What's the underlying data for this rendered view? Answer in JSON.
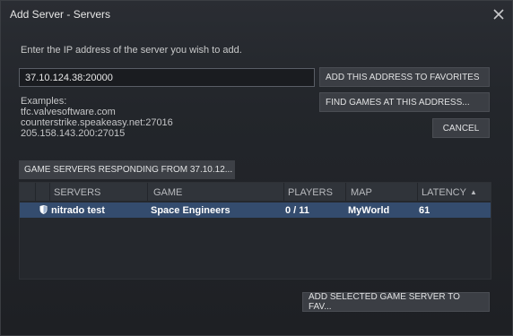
{
  "window": {
    "title": "Add Server - Servers"
  },
  "form": {
    "prompt": "Enter the IP address of the server you wish to add.",
    "ip_value": "37.10.124.38:20000"
  },
  "buttons": {
    "add_to_favorites": "ADD THIS ADDRESS TO FAVORITES",
    "find_games": "FIND GAMES AT THIS ADDRESS...",
    "cancel": "CANCEL",
    "add_selected": "ADD SELECTED GAME SERVER TO FAV..."
  },
  "examples": {
    "heading": "Examples:",
    "lines": [
      "tfc.valvesoftware.com",
      "counterstrike.speakeasy.net:27016",
      "205.158.143.200:27015"
    ]
  },
  "tab": {
    "label": "GAME SERVERS RESPONDING FROM 37.10.12..."
  },
  "table": {
    "columns": [
      "SERVERS",
      "GAME",
      "PLAYERS",
      "MAP",
      "LATENCY"
    ],
    "sort_indicator": "▲",
    "rows": [
      {
        "server": "nitrado test",
        "game": "Space Engineers",
        "players": "0 / 11",
        "map": "MyWorld",
        "latency": "61"
      }
    ]
  },
  "colors": {
    "selected_row": "#344c6e",
    "background": "#1c1e22"
  }
}
